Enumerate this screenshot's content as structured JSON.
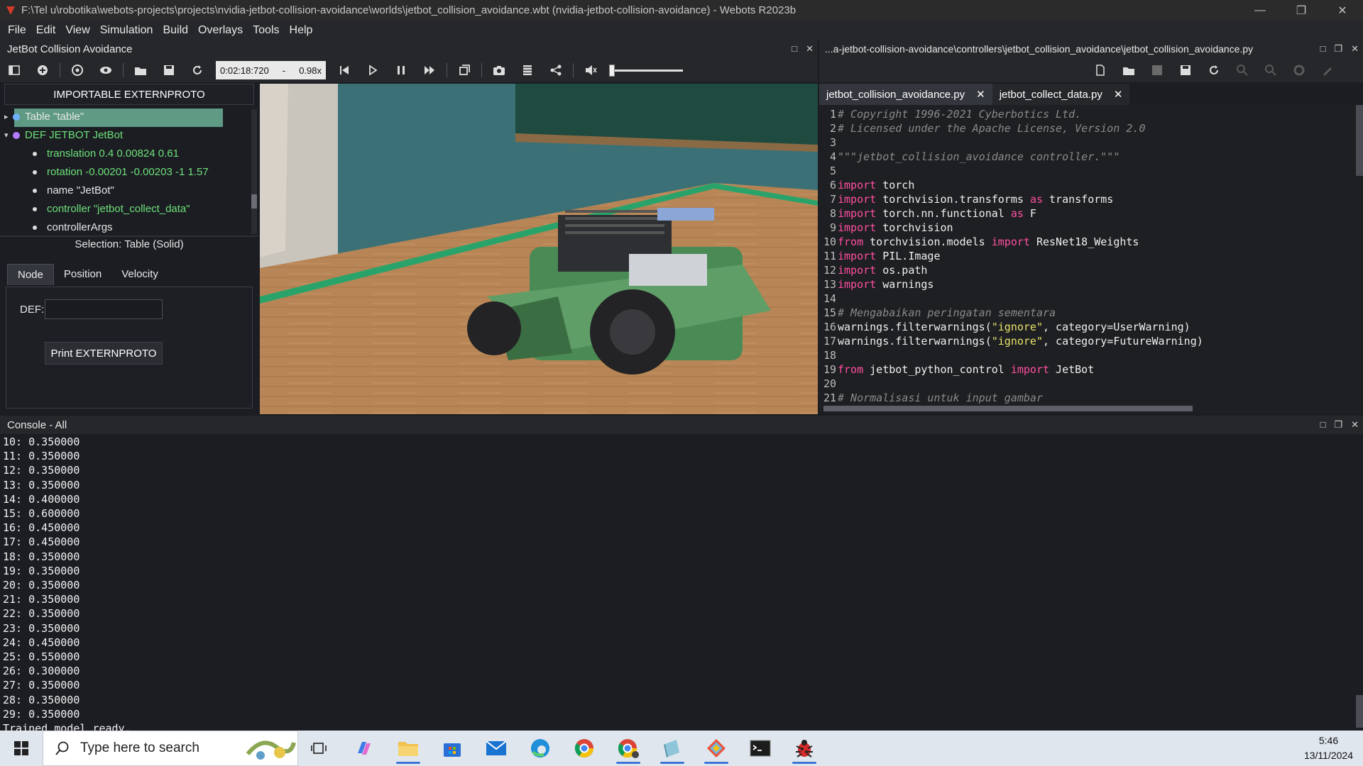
{
  "window": {
    "title": "F:\\Tel u\\robotika\\webots-projects\\projects\\nvidia-jetbot-collision-avoidance\\worlds\\jetbot_collision_avoidance.wbt (nvidia-jetbot-collision-avoidance) - Webots R2023b"
  },
  "menu": [
    "File",
    "Edit",
    "View",
    "Simulation",
    "Build",
    "Overlays",
    "Tools",
    "Help"
  ],
  "scene_panel": {
    "title": "JetBot Collision Avoidance",
    "time": "0:02:18:720",
    "speed_sep": "-",
    "speed": "0.98x",
    "import_button": "IMPORTABLE EXTERNPROTO",
    "tree": [
      {
        "label": "Table \"table\"",
        "dot_color": "#6fb1ff"
      },
      {
        "label": "DEF JETBOT JetBot",
        "dot_color": "#b57bff"
      }
    ],
    "fields": [
      {
        "label": "translation 0.4 0.00824 0.61",
        "modified": true
      },
      {
        "label": "rotation -0.00201 -0.00203 -1 1.57",
        "modified": true
      },
      {
        "label": "name \"JetBot\"",
        "modified": false
      },
      {
        "label": "controller \"jetbot_collect_data\"",
        "modified": true
      },
      {
        "label": "controllerArgs",
        "modified": false
      }
    ],
    "selection": "Selection: Table (Solid)",
    "tabs": [
      "Node",
      "Position",
      "Velocity"
    ],
    "def_label": "DEF:",
    "def_value": "",
    "print_button": "Print EXTERNPROTO"
  },
  "editor": {
    "path_title": "...a-jetbot-collision-avoidance\\controllers\\jetbot_collision_avoidance\\jetbot_collision_avoidance.py",
    "tabs": [
      {
        "label": "jetbot_collision_avoidance.py",
        "active": true
      },
      {
        "label": "jetbot_collect_data.py",
        "active": false
      }
    ],
    "lines": [
      {
        "n": "1",
        "t": "# Copyright 1996-2021 Cyberbotics Ltd."
      },
      {
        "n": "2",
        "t": "# Licensed under the Apache License, Version 2.0"
      },
      {
        "n": "3",
        "t": ""
      },
      {
        "n": "4",
        "t": "\"\"\"jetbot_collision_avoidance controller.\"\"\""
      },
      {
        "n": "5",
        "t": ""
      },
      {
        "n": "6",
        "t": "import torch"
      },
      {
        "n": "7",
        "t": "import torchvision.transforms as transforms"
      },
      {
        "n": "8",
        "t": "import torch.nn.functional as F"
      },
      {
        "n": "9",
        "t": "import torchvision"
      },
      {
        "n": "10",
        "t": "from torchvision.models import ResNet18_Weights"
      },
      {
        "n": "11",
        "t": "import PIL.Image"
      },
      {
        "n": "12",
        "t": "import os.path"
      },
      {
        "n": "13",
        "t": "import warnings"
      },
      {
        "n": "14",
        "t": ""
      },
      {
        "n": "15",
        "t": "# Mengabaikan peringatan sementara"
      },
      {
        "n": "16",
        "t": "warnings.filterwarnings(\"ignore\", category=UserWarning)"
      },
      {
        "n": "17",
        "t": "warnings.filterwarnings(\"ignore\", category=FutureWarning)"
      },
      {
        "n": "18",
        "t": ""
      },
      {
        "n": "19",
        "t": "from jetbot_python_control import JetBot"
      },
      {
        "n": "20",
        "t": ""
      },
      {
        "n": "21",
        "t": "# Normalisasi untuk input gambar"
      }
    ]
  },
  "console": {
    "title": "Console - All",
    "lines": [
      "10: 0.350000",
      "11: 0.350000",
      "12: 0.350000",
      "13: 0.350000",
      "14: 0.400000",
      "15: 0.600000",
      "16: 0.450000",
      "17: 0.450000",
      "18: 0.350000",
      "19: 0.350000",
      "20: 0.350000",
      "21: 0.350000",
      "22: 0.350000",
      "23: 0.350000",
      "24: 0.450000",
      "25: 0.550000",
      "26: 0.300000",
      "27: 0.350000",
      "28: 0.350000",
      "29: 0.350000",
      "Trained model ready."
    ]
  },
  "taskbar": {
    "search_placeholder": "Type here to search",
    "time": "5:46",
    "date": "13/11/2024",
    "apps": [
      "task-view-icon",
      "copilot-icon",
      "file-explorer-icon",
      "microsoft-store-icon",
      "mail-icon",
      "edge-icon",
      "chrome-icon",
      "chrome-profile-icon",
      "notepad-icon",
      "git-icon",
      "terminal-icon",
      "webots-icon"
    ]
  }
}
